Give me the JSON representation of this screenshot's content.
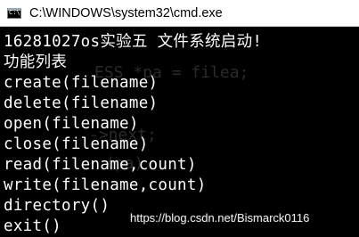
{
  "window": {
    "title": "C:\\WINDOWS\\system32\\cmd.exe",
    "icon": "cmd-console-icon",
    "icon_prompt": "C:\\"
  },
  "console": {
    "lines": [
      "16281027os实验五 文件系统启动!",
      "功能列表",
      "create(filename)",
      "delete(filename)",
      "open(filename)",
      "close(filename)",
      "read(filename,count)",
      "write(filename,count)",
      "directory()",
      "exit()"
    ],
    "background_text": [
      "ESS *pa = filea;",
      "->next;",
      "(pa)"
    ]
  },
  "watermark": {
    "text": "https://blog.csdn.net/Bismarck0116"
  },
  "colors": {
    "console_background": "#000000",
    "console_text": "#ffffff",
    "titlebar_background": "#ffffff"
  }
}
